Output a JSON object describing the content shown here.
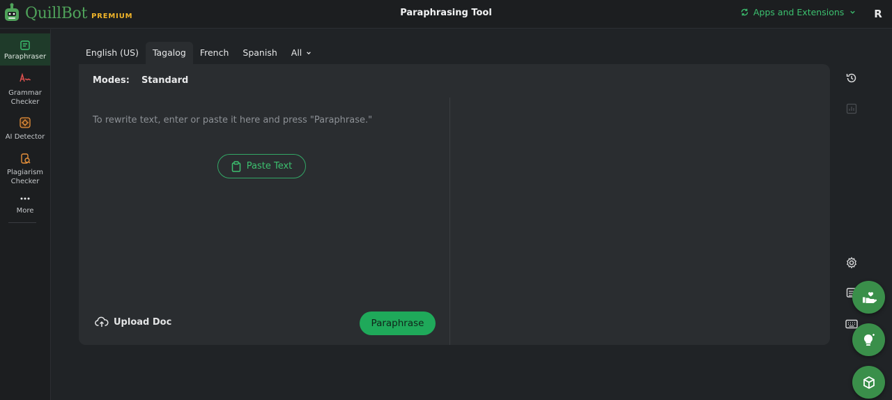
{
  "app": {
    "brand_name": "QuillBot",
    "brand_tier": "PREMIUM",
    "page_title": "Paraphrasing Tool",
    "apps_extensions_label": "Apps and Extensions",
    "avatar_initial": "R"
  },
  "sidebar": {
    "items": [
      {
        "label": "Paraphraser",
        "icon": "paraphraser-icon",
        "active": true
      },
      {
        "label": "Grammar Checker",
        "icon": "grammar-checker-icon"
      },
      {
        "label": "AI Detector",
        "icon": "ai-detector-icon"
      },
      {
        "label": "Plagiarism Checker",
        "icon": "plagiarism-checker-icon"
      },
      {
        "label": "More",
        "icon": "more-dots-icon"
      }
    ]
  },
  "languages": {
    "tabs": [
      "English (US)",
      "Tagalog",
      "French",
      "Spanish"
    ],
    "selected": "Tagalog",
    "all_label": "All"
  },
  "editor": {
    "modes_label": "Modes:",
    "mode_value": "Standard",
    "placeholder": "To rewrite text, enter or paste it here and press \"Paraphrase.\"",
    "paste_label": "Paste Text",
    "upload_label": "Upload Doc",
    "paraphrase_label": "Paraphrase"
  },
  "right_tools": [
    "history-icon",
    "stats-icon",
    "settings-icon",
    "notes-icon",
    "keyboard-icon"
  ],
  "fabs": [
    "hand-heart-icon",
    "lightbulb-icon",
    "cube-icon"
  ],
  "colors": {
    "accent": "#3cc06f",
    "primary_button": "#1fa95a",
    "premium": "#f0b429",
    "background": "#202326",
    "card": "#2a2d30"
  }
}
